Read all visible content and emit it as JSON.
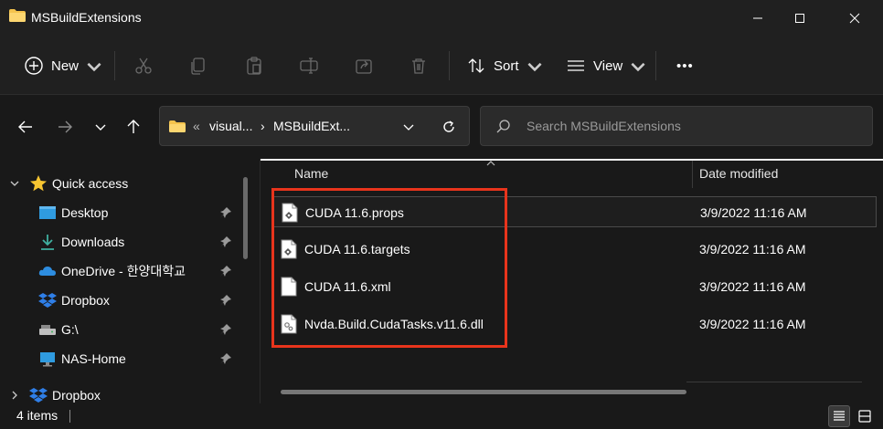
{
  "window": {
    "title": "MSBuildExtensions",
    "folder_color": "#f4c34d"
  },
  "toolbar": {
    "new_label": "New",
    "sort_label": "Sort",
    "view_label": "View",
    "more_label": "•••"
  },
  "address": {
    "overflow": "«",
    "crumb_parent": "visual...",
    "separator": "›",
    "crumb_current": "MSBuildExt..."
  },
  "search": {
    "placeholder": "Search MSBuildExtensions"
  },
  "sidebar": {
    "quick_access": "Quick access",
    "items": [
      {
        "label": "Desktop",
        "icon": "desktop-icon",
        "pinned": true
      },
      {
        "label": "Downloads",
        "icon": "download-icon",
        "pinned": true
      },
      {
        "label": "OneDrive - 한양대학교",
        "icon": "onedrive-icon",
        "pinned": true
      },
      {
        "label": "Dropbox",
        "icon": "dropbox-icon",
        "pinned": true
      },
      {
        "label": "G:\\",
        "icon": "drive-icon",
        "pinned": true
      },
      {
        "label": "NAS-Home",
        "icon": "network-icon",
        "pinned": true
      }
    ],
    "dropbox_root": "Dropbox"
  },
  "columns": {
    "name": "Name",
    "date": "Date modified"
  },
  "files": [
    {
      "name": "CUDA 11.6.props",
      "date": "3/9/2022 11:16 AM",
      "icon": "props-file-icon"
    },
    {
      "name": "CUDA 11.6.targets",
      "date": "3/9/2022 11:16 AM",
      "icon": "targets-file-icon"
    },
    {
      "name": "CUDA 11.6.xml",
      "date": "3/9/2022 11:16 AM",
      "icon": "xml-file-icon"
    },
    {
      "name": "Nvda.Build.CudaTasks.v11.6.dll",
      "date": "3/9/2022 11:16 AM",
      "icon": "dll-file-icon"
    }
  ],
  "status": {
    "item_count": "4 items"
  },
  "colors": {
    "highlight": "#e8341c",
    "accent": "#3a96dd"
  }
}
